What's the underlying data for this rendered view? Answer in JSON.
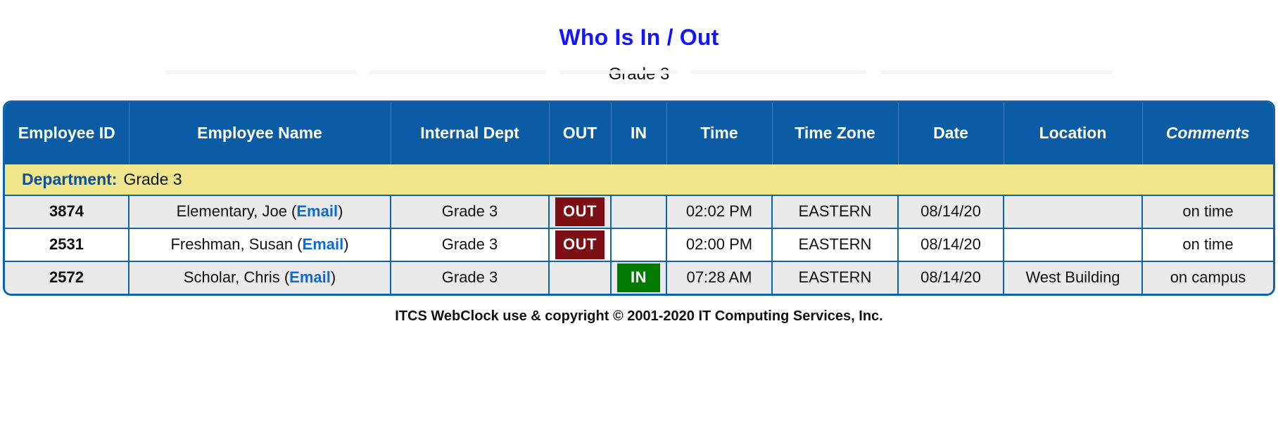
{
  "page": {
    "title": "Who Is In / Out",
    "subtitle": "Grade 3"
  },
  "colors": {
    "title": "#1414FF",
    "header_bg": "#0B5CA5",
    "dept_bg": "#F0E68C",
    "out_badge": "#7B0F13",
    "in_badge": "#017C01",
    "link": "#0B6BD6",
    "table_border": "#0F63AD"
  },
  "table": {
    "columns": [
      {
        "key": "employee_id",
        "label": "Employee ID",
        "style": "bold"
      },
      {
        "key": "employee_name",
        "label": "Employee Name",
        "style": "bold"
      },
      {
        "key": "internal_dept",
        "label": "Internal Dept",
        "style": "bold"
      },
      {
        "key": "out",
        "label": "OUT",
        "style": "bold"
      },
      {
        "key": "in",
        "label": "IN",
        "style": "bold"
      },
      {
        "key": "time",
        "label": "Time",
        "style": "bold"
      },
      {
        "key": "time_zone",
        "label": "Time Zone",
        "style": "bold"
      },
      {
        "key": "date",
        "label": "Date",
        "style": "bold"
      },
      {
        "key": "location",
        "label": "Location",
        "style": "bold"
      },
      {
        "key": "comments",
        "label": "Comments",
        "style": "bold-italic"
      }
    ],
    "department_band": {
      "label": "Department:",
      "value": "Grade 3"
    },
    "rows": [
      {
        "employee_id": "3874",
        "name_text": "Elementary, Joe (",
        "email_label": "Email",
        "name_tail": ")",
        "internal_dept": "Grade 3",
        "out": "OUT",
        "in": "",
        "time": "02:02 PM",
        "time_zone": "EASTERN",
        "date": "08/14/20",
        "location": "",
        "comments": "on time"
      },
      {
        "employee_id": "2531",
        "name_text": "Freshman, Susan (",
        "email_label": "Email",
        "name_tail": ")",
        "internal_dept": "Grade 3",
        "out": "OUT",
        "in": "",
        "time": "02:00 PM",
        "time_zone": "EASTERN",
        "date": "08/14/20",
        "location": "",
        "comments": "on time"
      },
      {
        "employee_id": "2572",
        "name_text": "Scholar, Chris (",
        "email_label": "Email",
        "name_tail": ")",
        "internal_dept": "Grade 3",
        "out": "",
        "in": "IN",
        "time": "07:28 AM",
        "time_zone": "EASTERN",
        "date": "08/14/20",
        "location": "West Building",
        "comments": "on campus"
      }
    ]
  },
  "footer": {
    "copyright": "ITCS WebClock use & copyright © 2001-2020 IT Computing Services, Inc."
  }
}
